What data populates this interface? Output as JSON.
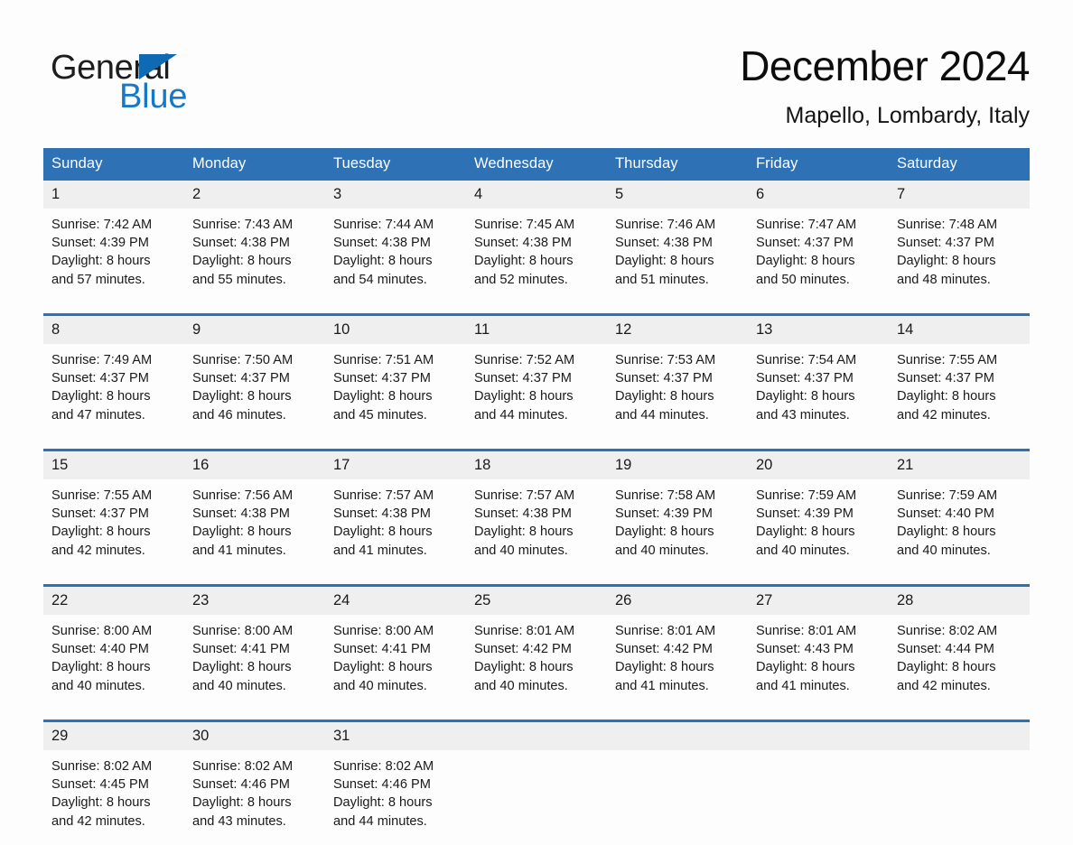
{
  "brand": {
    "name_part1": "General",
    "name_part2": "Blue",
    "triangle_color": "#0f6ab4",
    "blue_text_color": "#1878c4"
  },
  "header": {
    "title": "December 2024",
    "subtitle": "Mapello, Lombardy, Italy"
  },
  "theme": {
    "header_blue": "#2e72b5",
    "daynum_gray": "#efefef",
    "page_background": "#fdfdfd"
  },
  "weekday_headers": [
    "Sunday",
    "Monday",
    "Tuesday",
    "Wednesday",
    "Thursday",
    "Friday",
    "Saturday"
  ],
  "weeks": [
    [
      {
        "day": "1",
        "sunrise": "Sunrise: 7:42 AM",
        "sunset": "Sunset: 4:39 PM",
        "daylight_line1": "Daylight: 8 hours",
        "daylight_line2": "and 57 minutes."
      },
      {
        "day": "2",
        "sunrise": "Sunrise: 7:43 AM",
        "sunset": "Sunset: 4:38 PM",
        "daylight_line1": "Daylight: 8 hours",
        "daylight_line2": "and 55 minutes."
      },
      {
        "day": "3",
        "sunrise": "Sunrise: 7:44 AM",
        "sunset": "Sunset: 4:38 PM",
        "daylight_line1": "Daylight: 8 hours",
        "daylight_line2": "and 54 minutes."
      },
      {
        "day": "4",
        "sunrise": "Sunrise: 7:45 AM",
        "sunset": "Sunset: 4:38 PM",
        "daylight_line1": "Daylight: 8 hours",
        "daylight_line2": "and 52 minutes."
      },
      {
        "day": "5",
        "sunrise": "Sunrise: 7:46 AM",
        "sunset": "Sunset: 4:38 PM",
        "daylight_line1": "Daylight: 8 hours",
        "daylight_line2": "and 51 minutes."
      },
      {
        "day": "6",
        "sunrise": "Sunrise: 7:47 AM",
        "sunset": "Sunset: 4:37 PM",
        "daylight_line1": "Daylight: 8 hours",
        "daylight_line2": "and 50 minutes."
      },
      {
        "day": "7",
        "sunrise": "Sunrise: 7:48 AM",
        "sunset": "Sunset: 4:37 PM",
        "daylight_line1": "Daylight: 8 hours",
        "daylight_line2": "and 48 minutes."
      }
    ],
    [
      {
        "day": "8",
        "sunrise": "Sunrise: 7:49 AM",
        "sunset": "Sunset: 4:37 PM",
        "daylight_line1": "Daylight: 8 hours",
        "daylight_line2": "and 47 minutes."
      },
      {
        "day": "9",
        "sunrise": "Sunrise: 7:50 AM",
        "sunset": "Sunset: 4:37 PM",
        "daylight_line1": "Daylight: 8 hours",
        "daylight_line2": "and 46 minutes."
      },
      {
        "day": "10",
        "sunrise": "Sunrise: 7:51 AM",
        "sunset": "Sunset: 4:37 PM",
        "daylight_line1": "Daylight: 8 hours",
        "daylight_line2": "and 45 minutes."
      },
      {
        "day": "11",
        "sunrise": "Sunrise: 7:52 AM",
        "sunset": "Sunset: 4:37 PM",
        "daylight_line1": "Daylight: 8 hours",
        "daylight_line2": "and 44 minutes."
      },
      {
        "day": "12",
        "sunrise": "Sunrise: 7:53 AM",
        "sunset": "Sunset: 4:37 PM",
        "daylight_line1": "Daylight: 8 hours",
        "daylight_line2": "and 44 minutes."
      },
      {
        "day": "13",
        "sunrise": "Sunrise: 7:54 AM",
        "sunset": "Sunset: 4:37 PM",
        "daylight_line1": "Daylight: 8 hours",
        "daylight_line2": "and 43 minutes."
      },
      {
        "day": "14",
        "sunrise": "Sunrise: 7:55 AM",
        "sunset": "Sunset: 4:37 PM",
        "daylight_line1": "Daylight: 8 hours",
        "daylight_line2": "and 42 minutes."
      }
    ],
    [
      {
        "day": "15",
        "sunrise": "Sunrise: 7:55 AM",
        "sunset": "Sunset: 4:37 PM",
        "daylight_line1": "Daylight: 8 hours",
        "daylight_line2": "and 42 minutes."
      },
      {
        "day": "16",
        "sunrise": "Sunrise: 7:56 AM",
        "sunset": "Sunset: 4:38 PM",
        "daylight_line1": "Daylight: 8 hours",
        "daylight_line2": "and 41 minutes."
      },
      {
        "day": "17",
        "sunrise": "Sunrise: 7:57 AM",
        "sunset": "Sunset: 4:38 PM",
        "daylight_line1": "Daylight: 8 hours",
        "daylight_line2": "and 41 minutes."
      },
      {
        "day": "18",
        "sunrise": "Sunrise: 7:57 AM",
        "sunset": "Sunset: 4:38 PM",
        "daylight_line1": "Daylight: 8 hours",
        "daylight_line2": "and 40 minutes."
      },
      {
        "day": "19",
        "sunrise": "Sunrise: 7:58 AM",
        "sunset": "Sunset: 4:39 PM",
        "daylight_line1": "Daylight: 8 hours",
        "daylight_line2": "and 40 minutes."
      },
      {
        "day": "20",
        "sunrise": "Sunrise: 7:59 AM",
        "sunset": "Sunset: 4:39 PM",
        "daylight_line1": "Daylight: 8 hours",
        "daylight_line2": "and 40 minutes."
      },
      {
        "day": "21",
        "sunrise": "Sunrise: 7:59 AM",
        "sunset": "Sunset: 4:40 PM",
        "daylight_line1": "Daylight: 8 hours",
        "daylight_line2": "and 40 minutes."
      }
    ],
    [
      {
        "day": "22",
        "sunrise": "Sunrise: 8:00 AM",
        "sunset": "Sunset: 4:40 PM",
        "daylight_line1": "Daylight: 8 hours",
        "daylight_line2": "and 40 minutes."
      },
      {
        "day": "23",
        "sunrise": "Sunrise: 8:00 AM",
        "sunset": "Sunset: 4:41 PM",
        "daylight_line1": "Daylight: 8 hours",
        "daylight_line2": "and 40 minutes."
      },
      {
        "day": "24",
        "sunrise": "Sunrise: 8:00 AM",
        "sunset": "Sunset: 4:41 PM",
        "daylight_line1": "Daylight: 8 hours",
        "daylight_line2": "and 40 minutes."
      },
      {
        "day": "25",
        "sunrise": "Sunrise: 8:01 AM",
        "sunset": "Sunset: 4:42 PM",
        "daylight_line1": "Daylight: 8 hours",
        "daylight_line2": "and 40 minutes."
      },
      {
        "day": "26",
        "sunrise": "Sunrise: 8:01 AM",
        "sunset": "Sunset: 4:42 PM",
        "daylight_line1": "Daylight: 8 hours",
        "daylight_line2": "and 41 minutes."
      },
      {
        "day": "27",
        "sunrise": "Sunrise: 8:01 AM",
        "sunset": "Sunset: 4:43 PM",
        "daylight_line1": "Daylight: 8 hours",
        "daylight_line2": "and 41 minutes."
      },
      {
        "day": "28",
        "sunrise": "Sunrise: 8:02 AM",
        "sunset": "Sunset: 4:44 PM",
        "daylight_line1": "Daylight: 8 hours",
        "daylight_line2": "and 42 minutes."
      }
    ],
    [
      {
        "day": "29",
        "sunrise": "Sunrise: 8:02 AM",
        "sunset": "Sunset: 4:45 PM",
        "daylight_line1": "Daylight: 8 hours",
        "daylight_line2": "and 42 minutes."
      },
      {
        "day": "30",
        "sunrise": "Sunrise: 8:02 AM",
        "sunset": "Sunset: 4:46 PM",
        "daylight_line1": "Daylight: 8 hours",
        "daylight_line2": "and 43 minutes."
      },
      {
        "day": "31",
        "sunrise": "Sunrise: 8:02 AM",
        "sunset": "Sunset: 4:46 PM",
        "daylight_line1": "Daylight: 8 hours",
        "daylight_line2": "and 44 minutes."
      },
      {
        "day": "",
        "sunrise": "",
        "sunset": "",
        "daylight_line1": "",
        "daylight_line2": ""
      },
      {
        "day": "",
        "sunrise": "",
        "sunset": "",
        "daylight_line1": "",
        "daylight_line2": ""
      },
      {
        "day": "",
        "sunrise": "",
        "sunset": "",
        "daylight_line1": "",
        "daylight_line2": ""
      },
      {
        "day": "",
        "sunrise": "",
        "sunset": "",
        "daylight_line1": "",
        "daylight_line2": ""
      }
    ]
  ]
}
